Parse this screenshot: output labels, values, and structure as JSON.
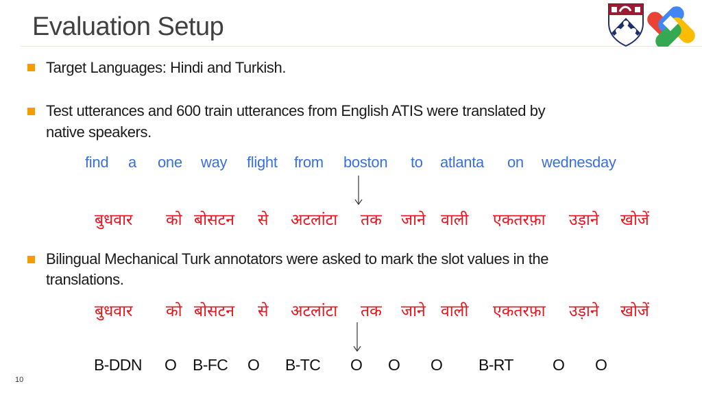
{
  "slide": {
    "title": "Evaluation Setup",
    "page_number": "10",
    "accent_color": "#f59c00",
    "english_color": "#3a6fe0",
    "hindi_color": "#e8141c"
  },
  "logos": [
    {
      "name": "penn-shield-logo"
    },
    {
      "name": "google-ai-logo"
    }
  ],
  "bullets": [
    {
      "lines": [
        "Target Languages: Hindi and Turkish."
      ]
    },
    {
      "lines": [
        "Test utterances and 600 train utterances from English ATIS were translated by",
        "native speakers."
      ]
    },
    {
      "lines": [
        "Bilingual Mechanical Turk annotators were asked to mark the slot values in the",
        "translations."
      ]
    }
  ],
  "english_sentence": [
    "find",
    "a",
    "one",
    "way",
    "flight",
    "from",
    "boston",
    "to",
    "atlanta",
    "on",
    "wednesday"
  ],
  "hindi_sentence": [
    "बुधवार",
    "को",
    "बोसटन",
    "से",
    "अटलांटा",
    "तक",
    "जाने",
    "वाली",
    "एकतरफ़ा",
    "उड़ाने",
    "खोजें"
  ],
  "slot_tags": [
    "B-DDN",
    "O",
    "B-FC",
    "O",
    "B-TC",
    "O",
    "O",
    "O",
    "B-RT",
    "O",
    "O"
  ]
}
